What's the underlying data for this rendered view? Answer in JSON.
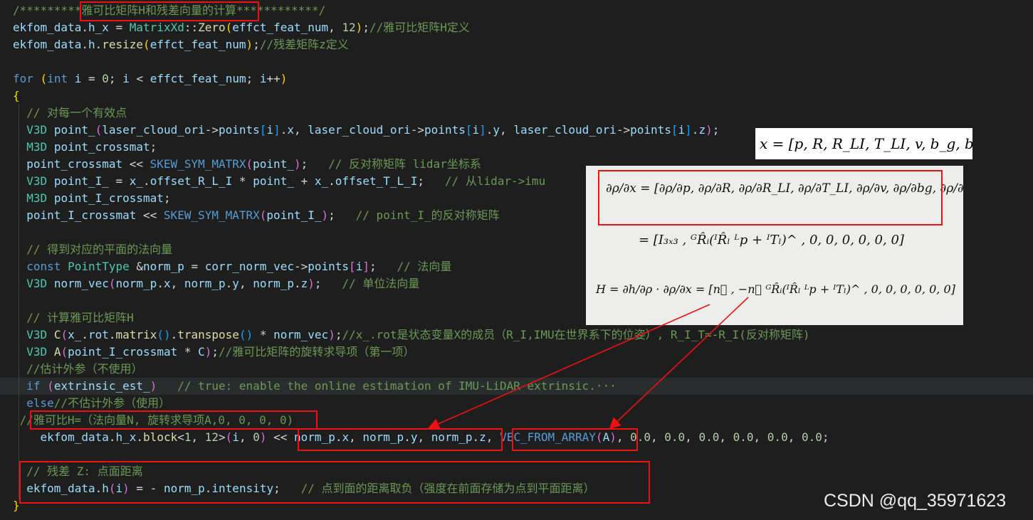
{
  "code_lines": [
    [
      {
        "t": "/*********",
        "c": "cm"
      },
      {
        "t": "雅可比矩阵H和残差向量的计算",
        "c": "cm"
      },
      {
        "t": "************/",
        "c": "cm"
      }
    ],
    [
      {
        "t": "ekfom_data",
        "c": "var"
      },
      {
        "t": ".",
        "c": "pl"
      },
      {
        "t": "h_x",
        "c": "var"
      },
      {
        "t": " = ",
        "c": "pl"
      },
      {
        "t": "MatrixXd",
        "c": "ty"
      },
      {
        "t": "::",
        "c": "pl"
      },
      {
        "t": "Zero",
        "c": "fn"
      },
      {
        "t": "(",
        "c": "br1"
      },
      {
        "t": "effct_feat_num",
        "c": "var"
      },
      {
        "t": ", ",
        "c": "pl"
      },
      {
        "t": "12",
        "c": "num"
      },
      {
        "t": ")",
        "c": "br1"
      },
      {
        "t": ";",
        "c": "pl"
      },
      {
        "t": "//雅可比矩阵H定义",
        "c": "cm"
      }
    ],
    [
      {
        "t": "ekfom_data",
        "c": "var"
      },
      {
        "t": ".",
        "c": "pl"
      },
      {
        "t": "h",
        "c": "var"
      },
      {
        "t": ".",
        "c": "pl"
      },
      {
        "t": "resize",
        "c": "fn"
      },
      {
        "t": "(",
        "c": "br1"
      },
      {
        "t": "effct_feat_num",
        "c": "var"
      },
      {
        "t": ")",
        "c": "br1"
      },
      {
        "t": ";",
        "c": "pl"
      },
      {
        "t": "//残差矩阵z定义",
        "c": "cm"
      }
    ],
    [],
    [
      {
        "t": "for",
        "c": "kw"
      },
      {
        "t": " ",
        "c": "pl"
      },
      {
        "t": "(",
        "c": "br1"
      },
      {
        "t": "int",
        "c": "kw"
      },
      {
        "t": " ",
        "c": "pl"
      },
      {
        "t": "i",
        "c": "var"
      },
      {
        "t": " = ",
        "c": "pl"
      },
      {
        "t": "0",
        "c": "num"
      },
      {
        "t": "; ",
        "c": "pl"
      },
      {
        "t": "i",
        "c": "var"
      },
      {
        "t": " < ",
        "c": "pl"
      },
      {
        "t": "effct_feat_num",
        "c": "var"
      },
      {
        "t": "; ",
        "c": "pl"
      },
      {
        "t": "i",
        "c": "var"
      },
      {
        "t": "++",
        "c": "pl"
      },
      {
        "t": ")",
        "c": "br1"
      }
    ],
    [
      {
        "t": "{",
        "c": "br1"
      }
    ],
    [
      {
        "t": "  ",
        "c": "pl"
      },
      {
        "t": "// 对每一个有效点",
        "c": "cm"
      }
    ],
    [
      {
        "t": "  ",
        "c": "pl"
      },
      {
        "t": "V3D",
        "c": "ty"
      },
      {
        "t": " ",
        "c": "pl"
      },
      {
        "t": "point_",
        "c": "var"
      },
      {
        "t": "(",
        "c": "br2"
      },
      {
        "t": "laser_cloud_ori",
        "c": "var"
      },
      {
        "t": "->",
        "c": "pl"
      },
      {
        "t": "points",
        "c": "var"
      },
      {
        "t": "[",
        "c": "br3"
      },
      {
        "t": "i",
        "c": "var"
      },
      {
        "t": "]",
        "c": "br3"
      },
      {
        "t": ".",
        "c": "pl"
      },
      {
        "t": "x",
        "c": "var"
      },
      {
        "t": ", ",
        "c": "pl"
      },
      {
        "t": "laser_cloud_ori",
        "c": "var"
      },
      {
        "t": "->",
        "c": "pl"
      },
      {
        "t": "points",
        "c": "var"
      },
      {
        "t": "[",
        "c": "br3"
      },
      {
        "t": "i",
        "c": "var"
      },
      {
        "t": "]",
        "c": "br3"
      },
      {
        "t": ".",
        "c": "pl"
      },
      {
        "t": "y",
        "c": "var"
      },
      {
        "t": ", ",
        "c": "pl"
      },
      {
        "t": "laser_cloud_ori",
        "c": "var"
      },
      {
        "t": "->",
        "c": "pl"
      },
      {
        "t": "points",
        "c": "var"
      },
      {
        "t": "[",
        "c": "br3"
      },
      {
        "t": "i",
        "c": "var"
      },
      {
        "t": "]",
        "c": "br3"
      },
      {
        "t": ".",
        "c": "pl"
      },
      {
        "t": "z",
        "c": "var"
      },
      {
        "t": ")",
        "c": "br2"
      },
      {
        "t": ";",
        "c": "pl"
      }
    ],
    [
      {
        "t": "  ",
        "c": "pl"
      },
      {
        "t": "M3D",
        "c": "ty"
      },
      {
        "t": " ",
        "c": "pl"
      },
      {
        "t": "point_crossmat",
        "c": "var"
      },
      {
        "t": ";",
        "c": "pl"
      }
    ],
    [
      {
        "t": "  ",
        "c": "pl"
      },
      {
        "t": "point_crossmat",
        "c": "var"
      },
      {
        "t": " << ",
        "c": "pl"
      },
      {
        "t": "SKEW_SYM_MATRX",
        "c": "mac"
      },
      {
        "t": "(",
        "c": "br2"
      },
      {
        "t": "point_",
        "c": "var"
      },
      {
        "t": ")",
        "c": "br2"
      },
      {
        "t": ";   ",
        "c": "pl"
      },
      {
        "t": "// 反对称矩阵 lidar坐标系",
        "c": "cm"
      }
    ],
    [
      {
        "t": "  ",
        "c": "pl"
      },
      {
        "t": "V3D",
        "c": "ty"
      },
      {
        "t": " ",
        "c": "pl"
      },
      {
        "t": "point_I_",
        "c": "var"
      },
      {
        "t": " = ",
        "c": "pl"
      },
      {
        "t": "x_",
        "c": "var"
      },
      {
        "t": ".",
        "c": "pl"
      },
      {
        "t": "offset_R_L_I",
        "c": "var"
      },
      {
        "t": " * ",
        "c": "pl"
      },
      {
        "t": "point_",
        "c": "var"
      },
      {
        "t": " + ",
        "c": "pl"
      },
      {
        "t": "x_",
        "c": "var"
      },
      {
        "t": ".",
        "c": "pl"
      },
      {
        "t": "offset_T_L_I",
        "c": "var"
      },
      {
        "t": ";   ",
        "c": "pl"
      },
      {
        "t": "// 从lidar->imu",
        "c": "cm"
      }
    ],
    [
      {
        "t": "  ",
        "c": "pl"
      },
      {
        "t": "M3D",
        "c": "ty"
      },
      {
        "t": " ",
        "c": "pl"
      },
      {
        "t": "point_I_crossmat",
        "c": "var"
      },
      {
        "t": ";",
        "c": "pl"
      }
    ],
    [
      {
        "t": "  ",
        "c": "pl"
      },
      {
        "t": "point_I_crossmat",
        "c": "var"
      },
      {
        "t": " << ",
        "c": "pl"
      },
      {
        "t": "SKEW_SYM_MATRX",
        "c": "mac"
      },
      {
        "t": "(",
        "c": "br2"
      },
      {
        "t": "point_I_",
        "c": "var"
      },
      {
        "t": ")",
        "c": "br2"
      },
      {
        "t": ";   ",
        "c": "pl"
      },
      {
        "t": "// point_I_的反对称矩阵",
        "c": "cm"
      }
    ],
    [],
    [
      {
        "t": "  ",
        "c": "pl"
      },
      {
        "t": "// 得到对应的平面的法向量",
        "c": "cm"
      }
    ],
    [
      {
        "t": "  ",
        "c": "pl"
      },
      {
        "t": "const",
        "c": "kw"
      },
      {
        "t": " ",
        "c": "pl"
      },
      {
        "t": "PointType",
        "c": "ty"
      },
      {
        "t": " &",
        "c": "pl"
      },
      {
        "t": "norm_p",
        "c": "var"
      },
      {
        "t": " = ",
        "c": "pl"
      },
      {
        "t": "corr_norm_vec",
        "c": "var"
      },
      {
        "t": "->",
        "c": "pl"
      },
      {
        "t": "points",
        "c": "var"
      },
      {
        "t": "[",
        "c": "br2"
      },
      {
        "t": "i",
        "c": "var"
      },
      {
        "t": "]",
        "c": "br2"
      },
      {
        "t": ";   ",
        "c": "pl"
      },
      {
        "t": "// 法向量",
        "c": "cm"
      }
    ],
    [
      {
        "t": "  ",
        "c": "pl"
      },
      {
        "t": "V3D",
        "c": "ty"
      },
      {
        "t": " ",
        "c": "pl"
      },
      {
        "t": "norm_vec",
        "c": "var"
      },
      {
        "t": "(",
        "c": "br2"
      },
      {
        "t": "norm_p",
        "c": "var"
      },
      {
        "t": ".",
        "c": "pl"
      },
      {
        "t": "x",
        "c": "var"
      },
      {
        "t": ", ",
        "c": "pl"
      },
      {
        "t": "norm_p",
        "c": "var"
      },
      {
        "t": ".",
        "c": "pl"
      },
      {
        "t": "y",
        "c": "var"
      },
      {
        "t": ", ",
        "c": "pl"
      },
      {
        "t": "norm_p",
        "c": "var"
      },
      {
        "t": ".",
        "c": "pl"
      },
      {
        "t": "z",
        "c": "var"
      },
      {
        "t": ")",
        "c": "br2"
      },
      {
        "t": ";   ",
        "c": "pl"
      },
      {
        "t": "// 单位法向量",
        "c": "cm"
      }
    ],
    [],
    [
      {
        "t": "  ",
        "c": "pl"
      },
      {
        "t": "// 计算雅可比矩阵H",
        "c": "cm"
      }
    ],
    [
      {
        "t": "  ",
        "c": "pl"
      },
      {
        "t": "V3D",
        "c": "ty"
      },
      {
        "t": " ",
        "c": "pl"
      },
      {
        "t": "C",
        "c": "fn"
      },
      {
        "t": "(",
        "c": "br2"
      },
      {
        "t": "x_",
        "c": "var"
      },
      {
        "t": ".",
        "c": "pl"
      },
      {
        "t": "rot",
        "c": "var"
      },
      {
        "t": ".",
        "c": "pl"
      },
      {
        "t": "matrix",
        "c": "fn"
      },
      {
        "t": "()",
        "c": "br3"
      },
      {
        "t": ".",
        "c": "pl"
      },
      {
        "t": "transpose",
        "c": "fn"
      },
      {
        "t": "()",
        "c": "br3"
      },
      {
        "t": " * ",
        "c": "pl"
      },
      {
        "t": "norm_vec",
        "c": "var"
      },
      {
        "t": ")",
        "c": "br2"
      },
      {
        "t": ";",
        "c": "pl"
      },
      {
        "t": "//x_.rot是状态变量X的成员（R_I,IMU在世界系下的位姿）, R_I_T=-R_I(反对称矩阵)",
        "c": "cm"
      }
    ],
    [
      {
        "t": "  ",
        "c": "pl"
      },
      {
        "t": "V3D",
        "c": "ty"
      },
      {
        "t": " ",
        "c": "pl"
      },
      {
        "t": "A",
        "c": "fn"
      },
      {
        "t": "(",
        "c": "br2"
      },
      {
        "t": "point_I_crossmat",
        "c": "var"
      },
      {
        "t": " * ",
        "c": "pl"
      },
      {
        "t": "C",
        "c": "var"
      },
      {
        "t": ")",
        "c": "br2"
      },
      {
        "t": ";",
        "c": "pl"
      },
      {
        "t": "//雅可比矩阵的旋转求导项（第一项）",
        "c": "cm"
      }
    ],
    [
      {
        "t": "  ",
        "c": "pl"
      },
      {
        "t": "//估计外参（不使用）",
        "c": "cm"
      }
    ],
    [
      {
        "t": "  ",
        "c": "pl"
      },
      {
        "t": "if",
        "c": "kw"
      },
      {
        "t": " ",
        "c": "pl"
      },
      {
        "t": "(",
        "c": "br2"
      },
      {
        "t": "extrinsic_est_",
        "c": "var"
      },
      {
        "t": ")",
        "c": "br2"
      },
      {
        "t": "   ",
        "c": "pl"
      },
      {
        "t": "// true: enable the online estimation of IMU-LiDAR extrinsic.···",
        "c": "cm"
      }
    ],
    [
      {
        "t": "  ",
        "c": "pl"
      },
      {
        "t": "else",
        "c": "kw"
      },
      {
        "t": "//不估计外参（使用）",
        "c": "cm"
      }
    ],
    [
      {
        "t": " ",
        "c": "pl"
      },
      {
        "t": "//雅可比H=（法向量N, 旋转求导项A,0, 0, 0, 0)",
        "c": "cm"
      }
    ],
    [
      {
        "t": "    ",
        "c": "pl"
      },
      {
        "t": "ekfom_data",
        "c": "var"
      },
      {
        "t": ".",
        "c": "pl"
      },
      {
        "t": "h_x",
        "c": "var"
      },
      {
        "t": ".",
        "c": "pl"
      },
      {
        "t": "block",
        "c": "fn"
      },
      {
        "t": "<",
        "c": "pl"
      },
      {
        "t": "1",
        "c": "num"
      },
      {
        "t": ", ",
        "c": "pl"
      },
      {
        "t": "12",
        "c": "num"
      },
      {
        "t": ">",
        "c": "pl"
      },
      {
        "t": "(",
        "c": "br2"
      },
      {
        "t": "i",
        "c": "var"
      },
      {
        "t": ", ",
        "c": "pl"
      },
      {
        "t": "0",
        "c": "num"
      },
      {
        "t": ")",
        "c": "br2"
      },
      {
        "t": " << ",
        "c": "pl"
      },
      {
        "t": "norm_p",
        "c": "var"
      },
      {
        "t": ".",
        "c": "pl"
      },
      {
        "t": "x",
        "c": "var"
      },
      {
        "t": ", ",
        "c": "pl"
      },
      {
        "t": "norm_p",
        "c": "var"
      },
      {
        "t": ".",
        "c": "pl"
      },
      {
        "t": "y",
        "c": "var"
      },
      {
        "t": ", ",
        "c": "pl"
      },
      {
        "t": "norm_p",
        "c": "var"
      },
      {
        "t": ".",
        "c": "pl"
      },
      {
        "t": "z",
        "c": "var"
      },
      {
        "t": ", ",
        "c": "pl"
      },
      {
        "t": "VEC_FROM_ARRAY",
        "c": "mac"
      },
      {
        "t": "(",
        "c": "br2"
      },
      {
        "t": "A",
        "c": "var"
      },
      {
        "t": ")",
        "c": "br2"
      },
      {
        "t": ", ",
        "c": "pl"
      },
      {
        "t": "0.0",
        "c": "num"
      },
      {
        "t": ", ",
        "c": "pl"
      },
      {
        "t": "0.0",
        "c": "num"
      },
      {
        "t": ", ",
        "c": "pl"
      },
      {
        "t": "0.0",
        "c": "num"
      },
      {
        "t": ", ",
        "c": "pl"
      },
      {
        "t": "0.0",
        "c": "num"
      },
      {
        "t": ", ",
        "c": "pl"
      },
      {
        "t": "0.0",
        "c": "num"
      },
      {
        "t": ", ",
        "c": "pl"
      },
      {
        "t": "0.0",
        "c": "num"
      },
      {
        "t": ";",
        "c": "pl"
      }
    ],
    [],
    [
      {
        "t": "  ",
        "c": "pl"
      },
      {
        "t": "// 残差 Z: 点面距离",
        "c": "cm"
      }
    ],
    [
      {
        "t": "  ",
        "c": "pl"
      },
      {
        "t": "ekfom_data",
        "c": "var"
      },
      {
        "t": ".",
        "c": "pl"
      },
      {
        "t": "h",
        "c": "var"
      },
      {
        "t": "(",
        "c": "br2"
      },
      {
        "t": "i",
        "c": "var"
      },
      {
        "t": ")",
        "c": "br2"
      },
      {
        "t": " = - ",
        "c": "pl"
      },
      {
        "t": "norm_p",
        "c": "var"
      },
      {
        "t": ".",
        "c": "pl"
      },
      {
        "t": "intensity",
        "c": "var"
      },
      {
        "t": ";   ",
        "c": "pl"
      },
      {
        "t": "// 点到面的距离取负（强度在前面存储为点到平面距离）",
        "c": "cm"
      }
    ],
    [
      {
        "t": "}",
        "c": "br1"
      }
    ]
  ],
  "highlighted_line": 22,
  "formula_bar": "x = [p, R, R_LI, T_LI, v, b_g, b_a, g]",
  "handwritten_notes": {
    "row1": "∂ρ/∂x = [∂ρ/∂p, ∂ρ/∂R, ∂ρ/∂R_LI, ∂ρ/∂T_LI, ∂ρ/∂v, ∂ρ/∂bg, ∂ρ/∂ba, ∂ρ/∂g]",
    "row2": "= [I₃ₓ₃ , ᴳR̂ᵢ(ᴵR̂ₗ ᴸp + ᴵTₗ)^ , 0, 0, 0, 0, 0, 0]",
    "row3": "H = ∂h/∂ρ · ∂ρ/∂x = [n⃗ , −n⃗ ᴳR̂ᵢ(ᴵR̂ₗ ᴸp + ᴵTₗ)^ , 0, 0, 0, 0, 0, 0]"
  },
  "watermark": "CSDN @qq_35971623",
  "colors": {
    "background": "#1e1e1e",
    "keyword": "#569cd6",
    "type": "#4ec9b0",
    "function": "#dcdcaa",
    "comment": "#6a9955",
    "variable": "#9cdcfe",
    "number": "#b5cea8",
    "annotation_red": "#ee1111"
  }
}
